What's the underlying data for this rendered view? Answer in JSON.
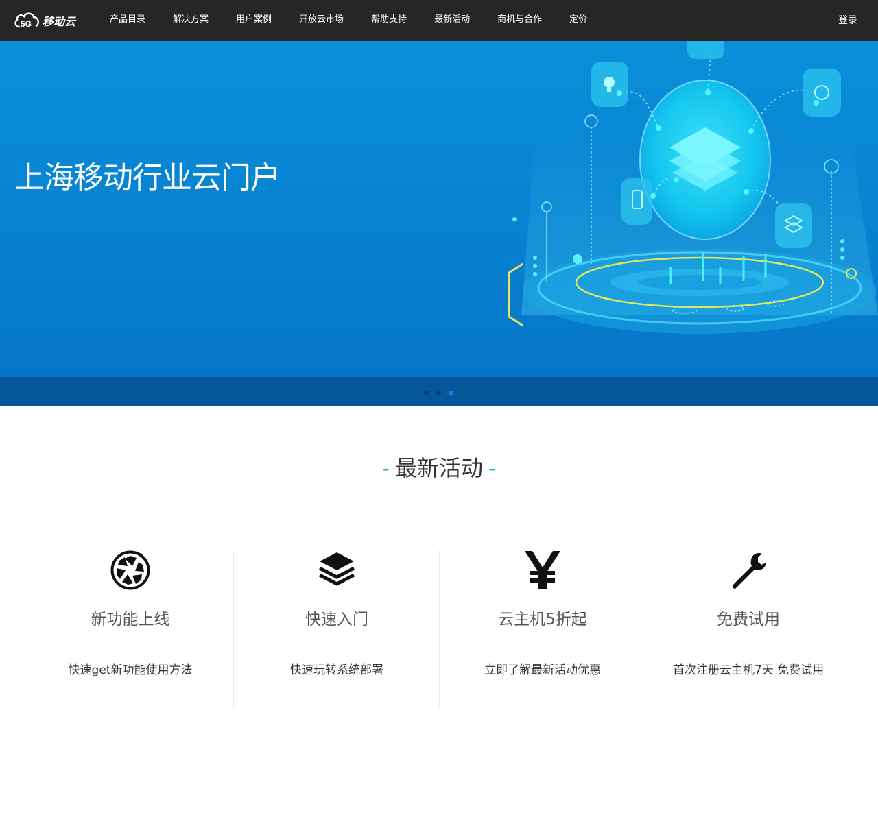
{
  "brand": {
    "logo_badge": "5G",
    "logo_text": "移动云"
  },
  "nav": {
    "items": [
      "产品目录",
      "解决方案",
      "用户案例",
      "开放云市场",
      "帮助支持",
      "最新活动",
      "商机与合作",
      "定价"
    ],
    "login": "登录"
  },
  "banner": {
    "title": "上海移动行业云门户",
    "slide_count": 3,
    "active_slide": 3
  },
  "section": {
    "title": "最新活动",
    "features": [
      {
        "icon": "aperture-icon",
        "title": "新功能上线",
        "desc": "快速get新功能使用方法"
      },
      {
        "icon": "layers-icon",
        "title": "快速入门",
        "desc": "快速玩转系统部署"
      },
      {
        "icon": "yen-icon",
        "title": "云主机5折起",
        "desc": "立即了解最新活动优惠"
      },
      {
        "icon": "wrench-icon",
        "title": "免费试用",
        "desc": "首次注册云主机7天 免费试用"
      }
    ]
  },
  "colors": {
    "nav_bg": "#262626",
    "banner_blue": "#0885d3",
    "dots_bar": "#05579a",
    "accent_cyan": "#21b6d6",
    "active_dot": "#1c7ee8"
  }
}
